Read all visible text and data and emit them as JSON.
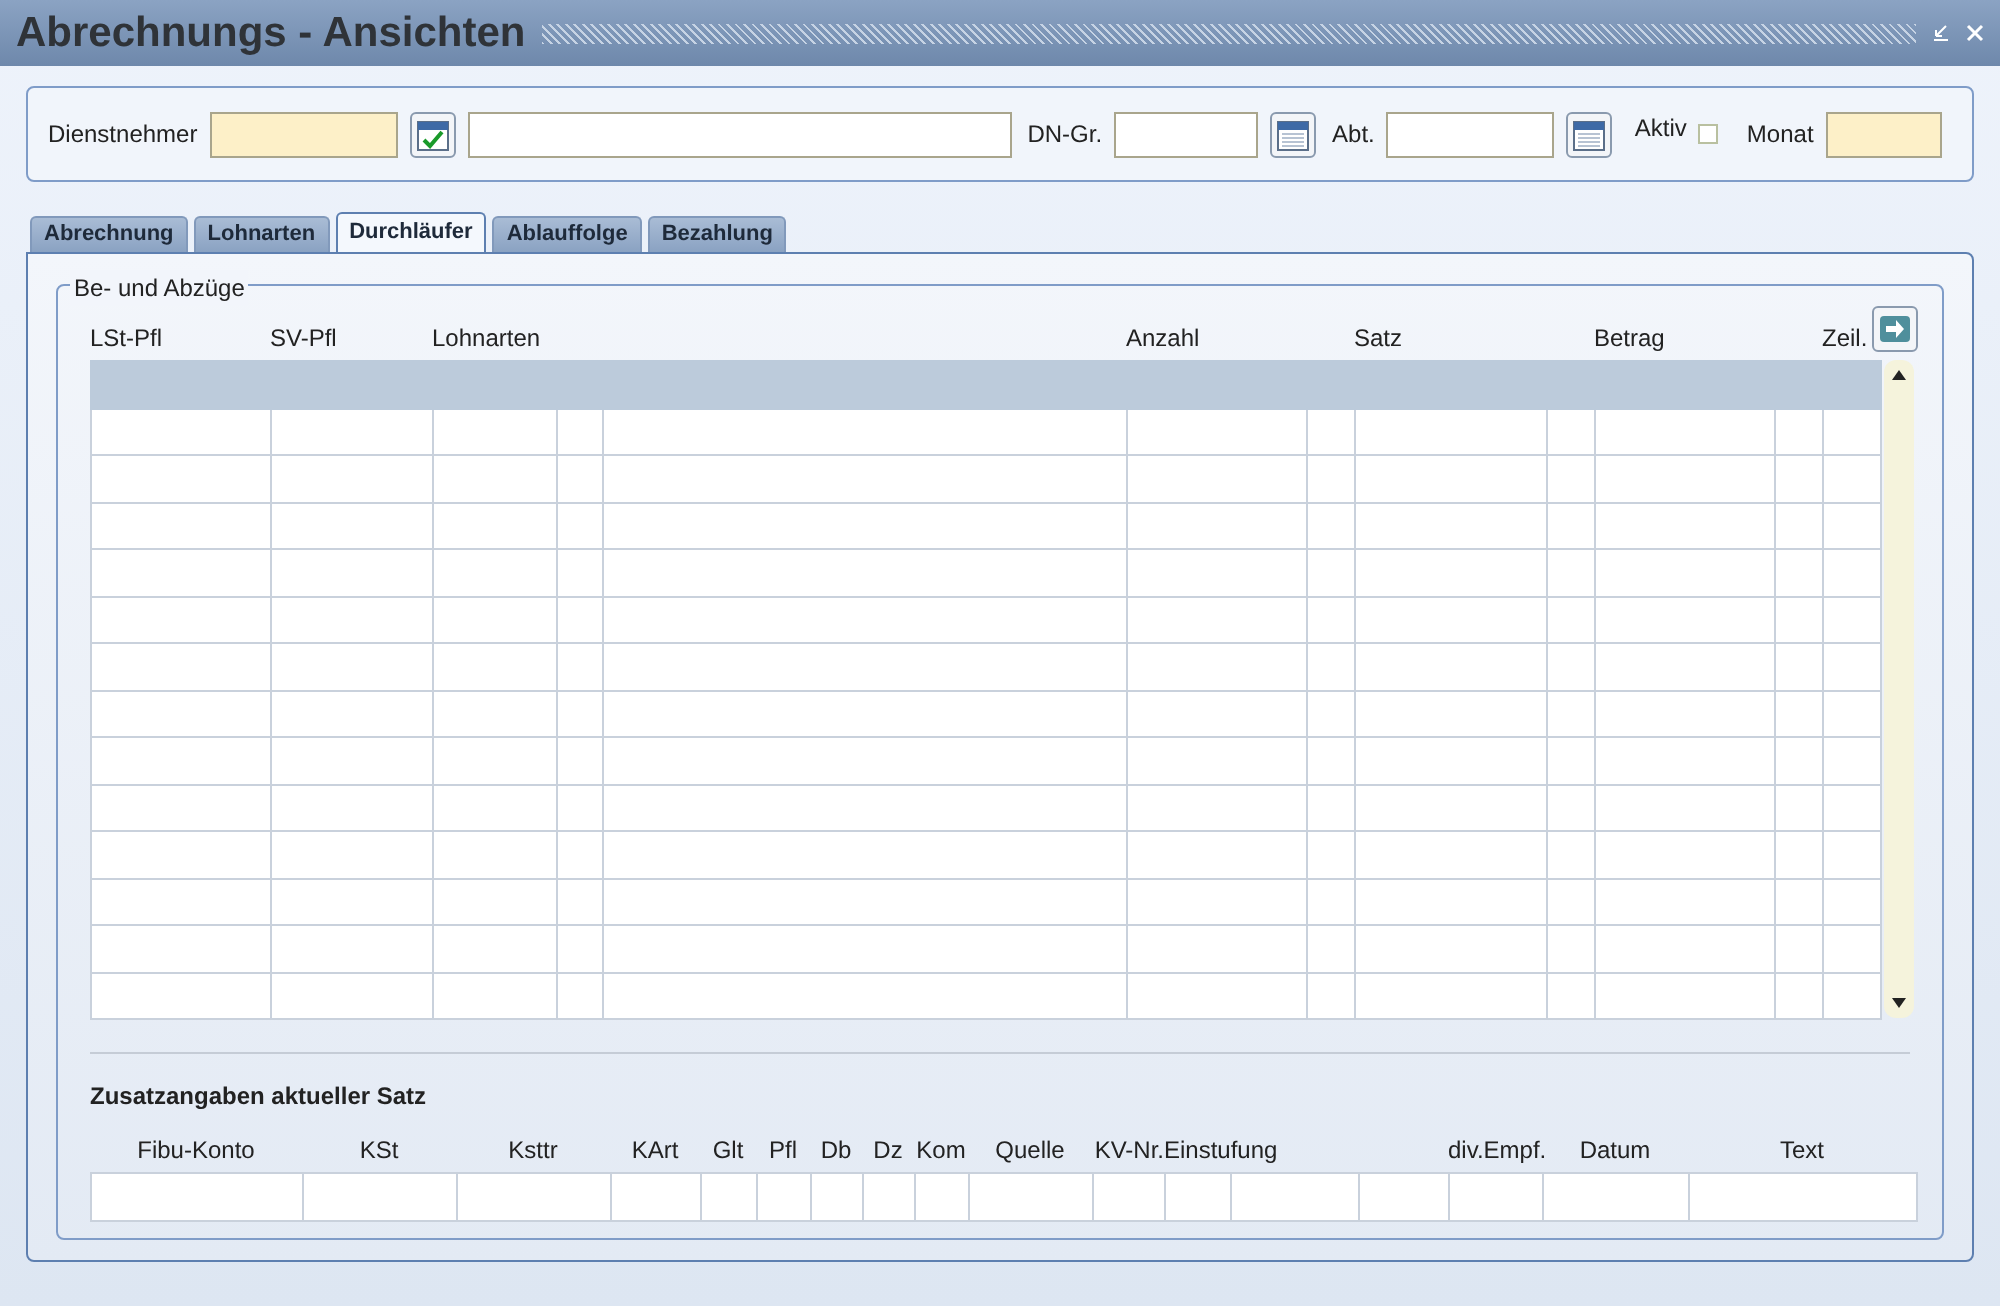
{
  "window": {
    "title": "Abrechnungs - Ansichten"
  },
  "filter": {
    "employee_label": "Dienstnehmer",
    "group_label": "DN-Gr.",
    "department_label": "Abt.",
    "active_label": "Aktiv",
    "active_checked": false,
    "month_label": "Monat"
  },
  "tabs": [
    {
      "label": "Abrechnung",
      "selected": false
    },
    {
      "label": "Lohnarten",
      "selected": false
    },
    {
      "label": "Durchläufer",
      "selected": true
    },
    {
      "label": "Ablauffolge",
      "selected": false
    },
    {
      "label": "Bezahlung",
      "selected": false
    }
  ],
  "group_title": "Be- und Abzüge",
  "table": {
    "columns": [
      {
        "label": "LSt-Pfl"
      },
      {
        "label": "SV-Pfl"
      },
      {
        "label": "Lohnarten"
      },
      {
        "label": "Anzahl"
      },
      {
        "label": "Satz"
      },
      {
        "label": "Betrag"
      },
      {
        "label": "Zeil."
      }
    ]
  },
  "details": {
    "title": "Zusatzangaben aktueller Satz",
    "columns": [
      {
        "label": "Fibu-Konto"
      },
      {
        "label": "KSt"
      },
      {
        "label": "Ksttr"
      },
      {
        "label": "KArt"
      },
      {
        "label": "Glt"
      },
      {
        "label": "Pfl"
      },
      {
        "label": "Db"
      },
      {
        "label": "Dz"
      },
      {
        "label": "Kom"
      },
      {
        "label": "Quelle"
      },
      {
        "label": "KV-Nr."
      },
      {
        "label": "Einstufung"
      },
      {
        "label": "div.Empf."
      },
      {
        "label": "Datum"
      },
      {
        "label": "Text"
      }
    ]
  }
}
